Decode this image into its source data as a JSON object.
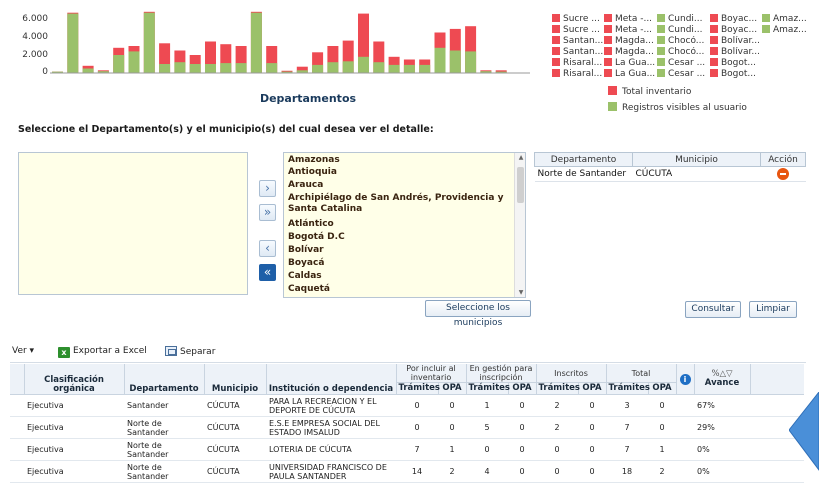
{
  "chart_data": {
    "type": "bar",
    "title": "Departamentos",
    "yticks": [
      "6.000",
      "4.000",
      "2.000",
      "0"
    ],
    "ylim": [
      0,
      7000
    ],
    "series": [
      {
        "name": "Total inventario",
        "color": "#ee4a52"
      },
      {
        "name": "Registros visibles al usuario",
        "color": "#9bc16a"
      }
    ],
    "totals": [
      150,
      6700,
      800,
      300,
      2800,
      3000,
      6800,
      3300,
      2500,
      2000,
      3500,
      3200,
      3000,
      6800,
      3000,
      250,
      700,
      2300,
      3000,
      3600,
      6600,
      3500,
      1800,
      1500,
      1500,
      4500,
      4900,
      5200,
      300,
      300
    ],
    "visible": [
      150,
      6600,
      500,
      200,
      2000,
      2400,
      6700,
      1000,
      1200,
      1000,
      1000,
      1100,
      1100,
      6700,
      1100,
      150,
      300,
      900,
      1200,
      1300,
      1800,
      1200,
      900,
      900,
      900,
      2800,
      2500,
      2400,
      200,
      150
    ]
  },
  "legend_grid": [
    [
      "Sucre ...",
      "Meta -...",
      "Cundi...",
      "Boyac...",
      "Amaz..."
    ],
    [
      "Sucre ...",
      "Meta -...",
      "Cundi...",
      "Boyac...",
      "Amaz..."
    ],
    [
      "Santan...",
      "Magda...",
      "Chocó...",
      "Bolívar...",
      ""
    ],
    [
      "Santan...",
      "Magda...",
      "Chocó...",
      "Bolívar...",
      ""
    ],
    [
      "Risaral...",
      "La Gua...",
      "Cesar ...",
      "Bogot...",
      ""
    ],
    [
      "Risaral...",
      "La Gua...",
      "Cesar ...",
      "Bogot...",
      ""
    ]
  ],
  "legend_grid_colors": [
    "#ee4a52",
    "#ee4a52",
    "#9bc16a",
    "#ee4a52",
    "#9bc16a"
  ],
  "instruction": "Seleccione el Departamento(s) y el municipio(s) del cual desea ver el detalle:",
  "departments": [
    "Amazonas",
    "Antioquia",
    "Arauca",
    "Archipiélago de San Andrés, Providencia y Santa Catalina",
    "Atlántico",
    "Bogotá D.C",
    "Bolívar",
    "Boyacá",
    "Caldas",
    "Caquetá"
  ],
  "selection_table": {
    "headers": [
      "Departamento",
      "Municipio",
      "Acción"
    ],
    "rows": [
      {
        "departamento": "Norte de Santander",
        "municipio": "CÚCUTA"
      }
    ]
  },
  "buttons": {
    "municipios": "Seleccione los municipios",
    "consultar": "Consultar",
    "limpiar": "Limpiar"
  },
  "toolbar": {
    "ver": "Ver ▾",
    "excel": "Exportar a Excel",
    "separar": "Separar"
  },
  "results": {
    "group_headers": {
      "por_incluir": "Por incluir al inventario",
      "en_gestion": "En gestión para inscripción",
      "inscritos": "Inscritos",
      "total": "Total"
    },
    "headers": {
      "clasificacion": "Clasificación orgánica",
      "departamento": "Departamento",
      "municipio": "Municipio",
      "institucion": "Institución o dependencia",
      "tramites": "Trámites",
      "opa": "OPA",
      "avance": "Avance",
      "avance_symbol": "%△▽"
    },
    "rows": [
      {
        "clasificacion": "Ejecutiva",
        "departamento": "Santander",
        "municipio": "CÚCUTA",
        "institucion": "PARA LA RECREACION Y EL DEPORTE DE CÚCUTA",
        "v": [
          "0",
          "0",
          "1",
          "0",
          "2",
          "0",
          "3",
          "0"
        ],
        "avance": "67%"
      },
      {
        "clasificacion": "Ejecutiva",
        "departamento": "Norte de Santander",
        "municipio": "CÚCUTA",
        "institucion": "E.S.E EMPRESA SOCIAL DEL ESTADO IMSALUD",
        "v": [
          "0",
          "0",
          "5",
          "0",
          "2",
          "0",
          "7",
          "0"
        ],
        "avance": "29%"
      },
      {
        "clasificacion": "Ejecutiva",
        "departamento": "Norte de Santander",
        "municipio": "CÚCUTA",
        "institucion": "LOTERIA DE CÚCUTA",
        "v": [
          "7",
          "1",
          "0",
          "0",
          "0",
          "0",
          "7",
          "1"
        ],
        "avance": "0%"
      },
      {
        "clasificacion": "Ejecutiva",
        "departamento": "Norte de Santander",
        "municipio": "CÚCUTA",
        "institucion": "UNIVERSIDAD FRANCISCO DE PAULA SANTANDER",
        "v": [
          "14",
          "2",
          "4",
          "0",
          "0",
          "0",
          "18",
          "2"
        ],
        "avance": "0%"
      }
    ]
  },
  "colors": {
    "accent": "#1e5fa8",
    "callout": "#4a8fd8"
  }
}
